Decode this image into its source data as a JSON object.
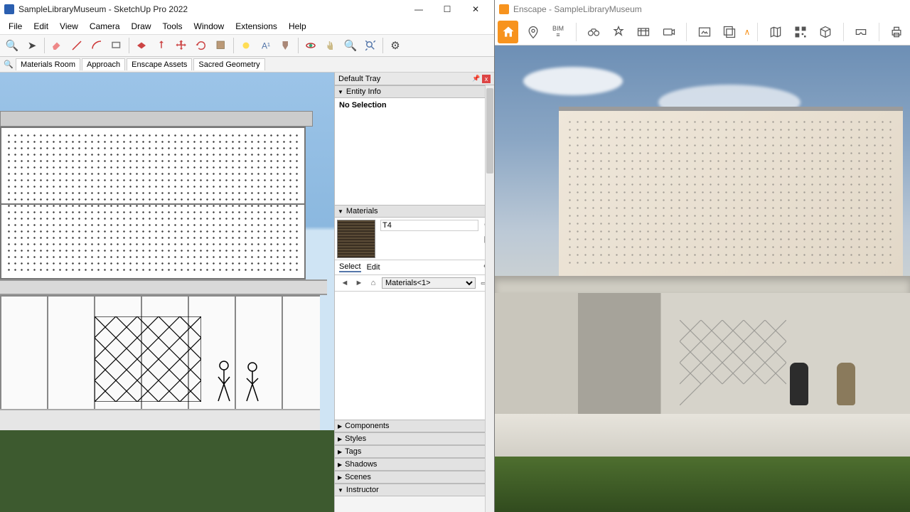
{
  "sketchup": {
    "title": "SampleLibraryMuseum - SketchUp Pro 2022",
    "menu": [
      "File",
      "Edit",
      "View",
      "Camera",
      "Draw",
      "Tools",
      "Window",
      "Extensions",
      "Help"
    ],
    "scenes": [
      "Materials Room",
      "Approach",
      "Enscape Assets",
      "Sacred Geometry"
    ],
    "tray": {
      "title": "Default Tray",
      "entity": {
        "header": "Entity Info",
        "noSelection": "No Selection"
      },
      "materials": {
        "header": "Materials",
        "name": "T4",
        "tabSelect": "Select",
        "tabEdit": "Edit",
        "library": "Materials<1>"
      },
      "collapsed": [
        "Components",
        "Styles",
        "Tags",
        "Shadows",
        "Scenes",
        "Instructor"
      ]
    }
  },
  "enscape": {
    "title": "Enscape - SampleLibraryMuseum",
    "bimLabel": "BIM"
  }
}
